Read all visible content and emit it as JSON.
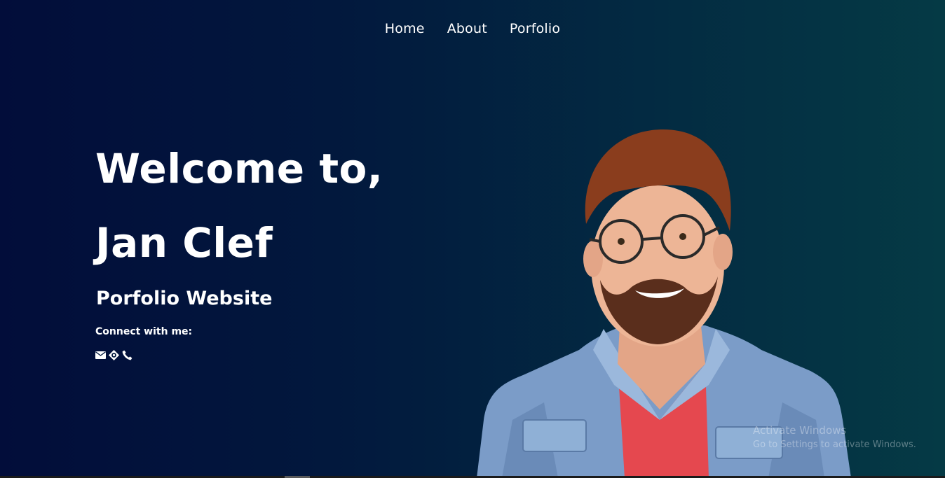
{
  "nav": {
    "items": [
      {
        "label": "Home"
      },
      {
        "label": "About"
      },
      {
        "label": "Porfolio"
      }
    ]
  },
  "hero": {
    "line1": "Welcome to,",
    "line2": "Jan Clef",
    "subtitle": "Porfolio Website",
    "connect_label": "Connect with me:",
    "icons": [
      "envelope-icon",
      "location-target-icon",
      "phone-icon"
    ]
  },
  "watermark": {
    "line1": "Activate Windows",
    "line2": "Go to Settings to activate Windows."
  },
  "colors": {
    "bg_left": "#020d3a",
    "bg_right": "#053a45",
    "text": "#ffffff"
  }
}
